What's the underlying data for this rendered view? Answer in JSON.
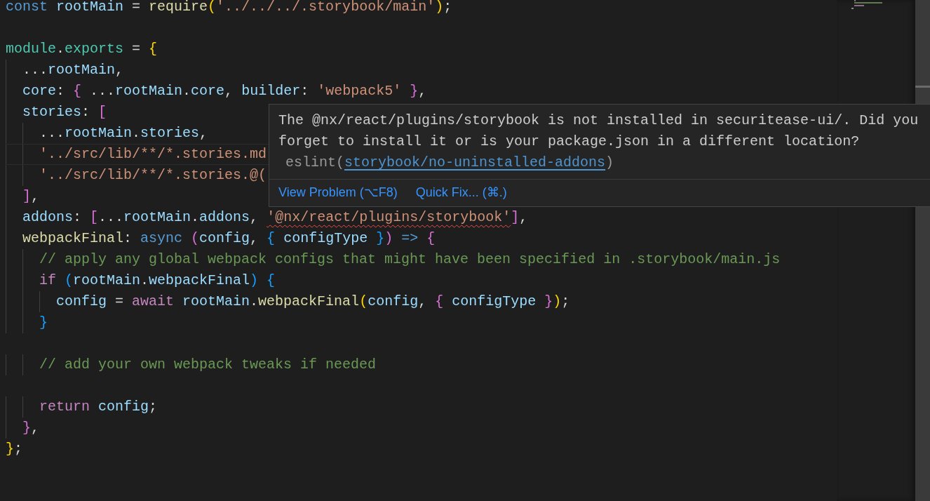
{
  "editor": {
    "lines": [
      {
        "kind": "code",
        "current": false,
        "tokens": [
          {
            "kind": "kw",
            "text": "const"
          },
          {
            "kind": "var",
            "text": " rootMain"
          },
          {
            "kind": "p",
            "text": " = "
          },
          {
            "kind": "fn",
            "text": "require"
          },
          {
            "kind": "b1",
            "text": "("
          },
          {
            "kind": "str",
            "text": "'../../../.storybook/main'"
          },
          {
            "kind": "b1",
            "text": ")"
          },
          {
            "kind": "p",
            "text": ";"
          }
        ]
      },
      {
        "kind": "blank",
        "current": false
      },
      {
        "kind": "code",
        "current": false,
        "tokens": [
          {
            "kind": "mod",
            "text": "module"
          },
          {
            "kind": "p",
            "text": "."
          },
          {
            "kind": "mod",
            "text": "exports"
          },
          {
            "kind": "p",
            "text": " = "
          },
          {
            "kind": "b1",
            "text": "{"
          }
        ]
      },
      {
        "kind": "code",
        "current": false,
        "tokens": [
          {
            "kind": "p",
            "text": "  ..."
          },
          {
            "kind": "var",
            "text": "rootMain"
          },
          {
            "kind": "p",
            "text": ","
          }
        ]
      },
      {
        "kind": "code",
        "current": false,
        "tokens": [
          {
            "kind": "var",
            "text": "  core"
          },
          {
            "kind": "p",
            "text": ": "
          },
          {
            "kind": "b2",
            "text": "{"
          },
          {
            "kind": "p",
            "text": " ..."
          },
          {
            "kind": "var",
            "text": "rootMain"
          },
          {
            "kind": "p",
            "text": "."
          },
          {
            "kind": "var",
            "text": "core"
          },
          {
            "kind": "p",
            "text": ", "
          },
          {
            "kind": "var",
            "text": "builder"
          },
          {
            "kind": "p",
            "text": ": "
          },
          {
            "kind": "str",
            "text": "'webpack5'"
          },
          {
            "kind": "b2",
            "text": " }"
          },
          {
            "kind": "p",
            "text": ","
          }
        ]
      },
      {
        "kind": "code",
        "current": false,
        "tokens": [
          {
            "kind": "var",
            "text": "  stories"
          },
          {
            "kind": "p",
            "text": ": "
          },
          {
            "kind": "b2",
            "text": "["
          }
        ]
      },
      {
        "kind": "code",
        "current": false,
        "tokens": [
          {
            "kind": "p",
            "text": "    ..."
          },
          {
            "kind": "var",
            "text": "rootMain"
          },
          {
            "kind": "p",
            "text": "."
          },
          {
            "kind": "var",
            "text": "stories"
          },
          {
            "kind": "p",
            "text": ","
          }
        ]
      },
      {
        "kind": "code",
        "current": true,
        "tokens": [
          {
            "kind": "str",
            "text": "    '../src/lib/**/*.stories.md"
          }
        ]
      },
      {
        "kind": "code",
        "current": false,
        "tokens": [
          {
            "kind": "str",
            "text": "    '../src/lib/**/*.stories.@("
          }
        ]
      },
      {
        "kind": "code",
        "current": false,
        "tokens": [
          {
            "kind": "b2",
            "text": "  ]"
          },
          {
            "kind": "p",
            "text": ","
          }
        ]
      },
      {
        "kind": "code",
        "current": false,
        "tokens": [
          {
            "kind": "var",
            "text": "  addons"
          },
          {
            "kind": "p",
            "text": ": "
          },
          {
            "kind": "b2",
            "text": "["
          },
          {
            "kind": "p",
            "text": "..."
          },
          {
            "kind": "var",
            "text": "rootMain"
          },
          {
            "kind": "p",
            "text": "."
          },
          {
            "kind": "var",
            "text": "addons"
          },
          {
            "kind": "p",
            "text": ", "
          },
          {
            "kind": "str_err",
            "text": "'@nx/react/plugins/storybook'"
          },
          {
            "kind": "b2",
            "text": "]"
          },
          {
            "kind": "p",
            "text": ","
          }
        ]
      },
      {
        "kind": "code",
        "current": false,
        "tokens": [
          {
            "kind": "fn",
            "text": "  webpackFinal"
          },
          {
            "kind": "p",
            "text": ": "
          },
          {
            "kind": "kw",
            "text": "async"
          },
          {
            "kind": "b2",
            "text": " ("
          },
          {
            "kind": "var",
            "text": "config"
          },
          {
            "kind": "p",
            "text": ", "
          },
          {
            "kind": "b3",
            "text": "{"
          },
          {
            "kind": "var",
            "text": " configType "
          },
          {
            "kind": "b3",
            "text": "}"
          },
          {
            "kind": "b2",
            "text": ")"
          },
          {
            "kind": "kw",
            "text": " =>"
          },
          {
            "kind": "b2",
            "text": " {"
          }
        ]
      },
      {
        "kind": "code",
        "current": false,
        "tokens": [
          {
            "kind": "cm",
            "text": "    // apply any global webpack configs that might have been specified in .storybook/main.js"
          }
        ]
      },
      {
        "kind": "code",
        "current": false,
        "tokens": [
          {
            "kind": "ctl",
            "text": "    if"
          },
          {
            "kind": "b3",
            "text": " ("
          },
          {
            "kind": "var",
            "text": "rootMain"
          },
          {
            "kind": "p",
            "text": "."
          },
          {
            "kind": "var",
            "text": "webpackFinal"
          },
          {
            "kind": "b3",
            "text": ")"
          },
          {
            "kind": "b3",
            "text": " {"
          }
        ]
      },
      {
        "kind": "code",
        "current": false,
        "tokens": [
          {
            "kind": "var",
            "text": "      config"
          },
          {
            "kind": "p",
            "text": " = "
          },
          {
            "kind": "ctl",
            "text": "await"
          },
          {
            "kind": "var",
            "text": " rootMain"
          },
          {
            "kind": "p",
            "text": "."
          },
          {
            "kind": "fn",
            "text": "webpackFinal"
          },
          {
            "kind": "b1",
            "text": "("
          },
          {
            "kind": "var",
            "text": "config"
          },
          {
            "kind": "p",
            "text": ", "
          },
          {
            "kind": "b2",
            "text": "{"
          },
          {
            "kind": "var",
            "text": " configType "
          },
          {
            "kind": "b2",
            "text": "}"
          },
          {
            "kind": "b1",
            "text": ")"
          },
          {
            "kind": "p",
            "text": ";"
          }
        ]
      },
      {
        "kind": "code",
        "current": false,
        "tokens": [
          {
            "kind": "b3",
            "text": "    }"
          }
        ]
      },
      {
        "kind": "blank",
        "current": false
      },
      {
        "kind": "code",
        "current": false,
        "tokens": [
          {
            "kind": "cm",
            "text": "    // add your own webpack tweaks if needed"
          }
        ]
      },
      {
        "kind": "blank",
        "current": false
      },
      {
        "kind": "code",
        "current": false,
        "tokens": [
          {
            "kind": "ctl",
            "text": "    return"
          },
          {
            "kind": "var",
            "text": " config"
          },
          {
            "kind": "p",
            "text": ";"
          }
        ]
      },
      {
        "kind": "code",
        "current": false,
        "tokens": [
          {
            "kind": "b2",
            "text": "  }"
          },
          {
            "kind": "p",
            "text": ","
          }
        ]
      },
      {
        "kind": "code",
        "current": false,
        "tokens": [
          {
            "kind": "b1",
            "text": "}"
          },
          {
            "kind": "p",
            "text": ";"
          }
        ]
      }
    ]
  },
  "hover": {
    "message": "The @nx/react/plugins/storybook is not installed in securitease-ui/. Did you forget to install it or is your package.json in a different location?",
    "source": {
      "prefix": "eslint(",
      "link": "storybook/no-uninstalled-addons",
      "suffix": ")"
    },
    "actions": [
      "View Problem (⌥F8)",
      "Quick Fix... (⌘.)"
    ]
  }
}
